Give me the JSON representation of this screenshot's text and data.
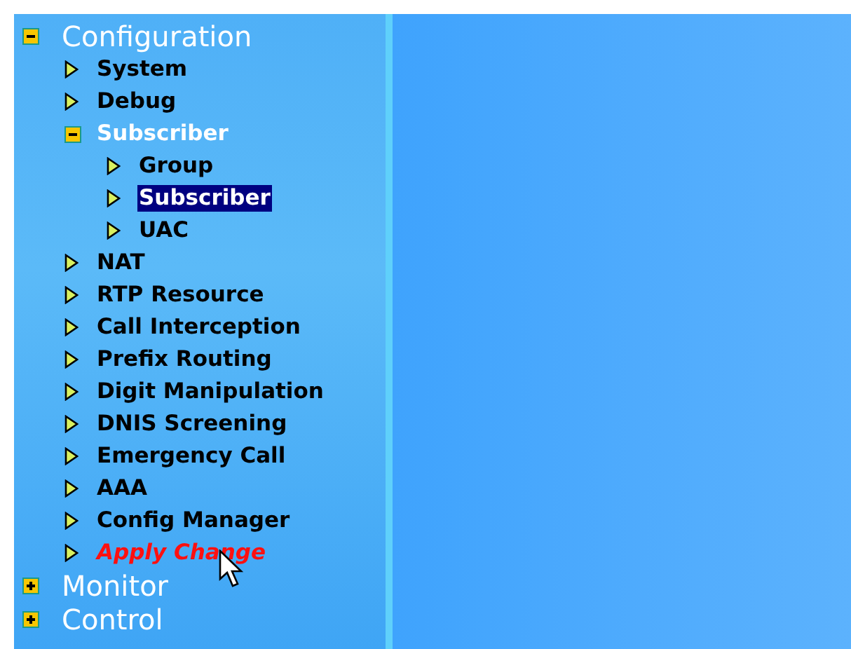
{
  "tree": [
    {
      "label": "Configuration",
      "kind": "folder",
      "expanded": true,
      "children": [
        {
          "label": "System",
          "kind": "leaf",
          "selected": false
        },
        {
          "label": "Debug",
          "kind": "leaf",
          "selected": false
        },
        {
          "label": "Subscriber",
          "kind": "folder",
          "expanded": true,
          "children": [
            {
              "label": "Group",
              "kind": "leaf",
              "selected": false
            },
            {
              "label": "Subscriber",
              "kind": "leaf",
              "selected": true
            },
            {
              "label": "UAC",
              "kind": "leaf",
              "selected": false
            }
          ]
        },
        {
          "label": "NAT",
          "kind": "leaf",
          "selected": false
        },
        {
          "label": "RTP Resource",
          "kind": "leaf",
          "selected": false
        },
        {
          "label": "Call Interception",
          "kind": "leaf",
          "selected": false
        },
        {
          "label": "Prefix Routing",
          "kind": "leaf",
          "selected": false
        },
        {
          "label": "Digit Manipulation",
          "kind": "leaf",
          "selected": false
        },
        {
          "label": "DNIS Screening",
          "kind": "leaf",
          "selected": false
        },
        {
          "label": "Emergency Call",
          "kind": "leaf",
          "selected": false
        },
        {
          "label": "AAA",
          "kind": "leaf",
          "selected": false
        },
        {
          "label": "Config Manager",
          "kind": "leaf",
          "selected": false
        },
        {
          "label": "Apply Change",
          "kind": "action",
          "selected": false
        }
      ]
    },
    {
      "label": "Monitor",
      "kind": "folder",
      "expanded": false
    },
    {
      "label": "Control",
      "kind": "folder",
      "expanded": false
    }
  ]
}
